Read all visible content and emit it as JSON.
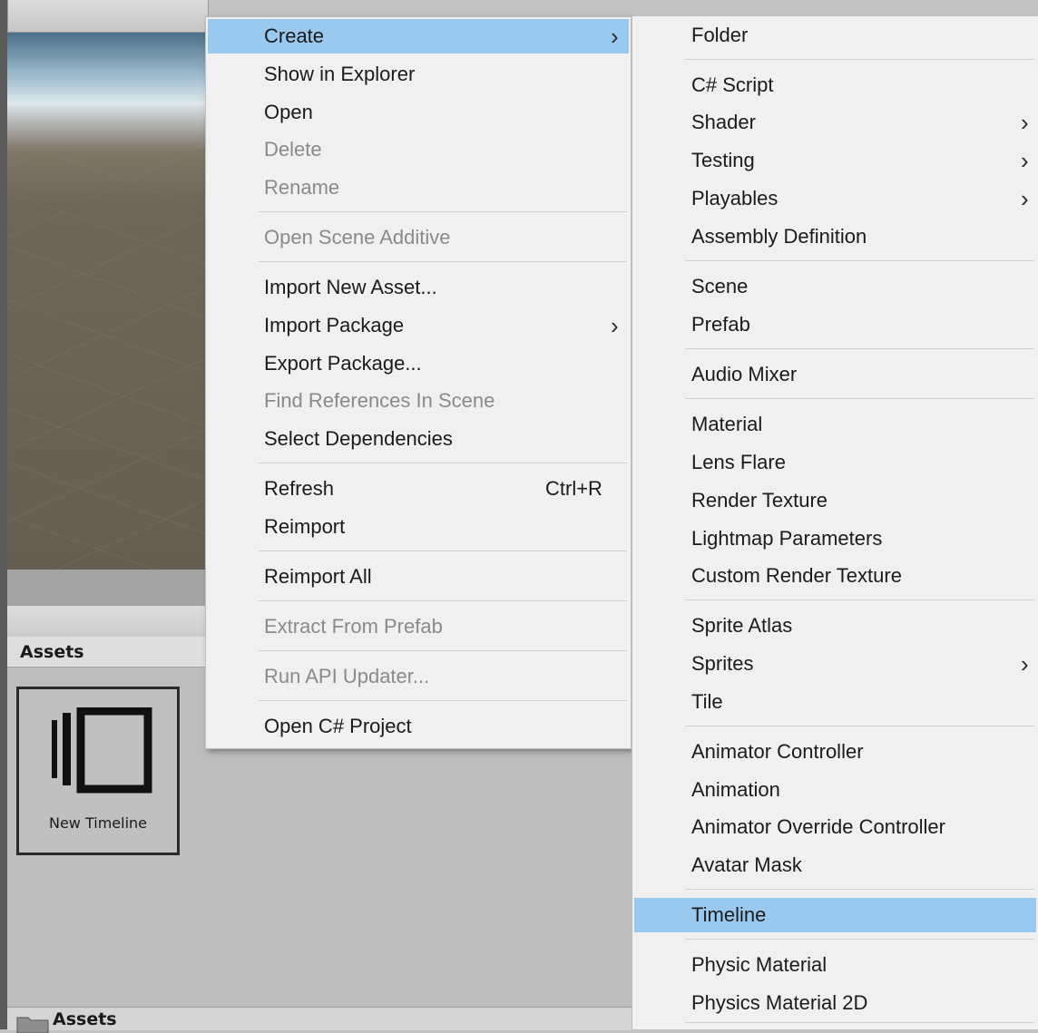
{
  "project": {
    "assets_header": "Assets",
    "asset_tile_label": "New Timeline",
    "status_label": "Assets"
  },
  "context_menu": {
    "items": [
      {
        "label": "Create",
        "submenu": true,
        "highlighted": true
      },
      {
        "label": "Show in Explorer"
      },
      {
        "label": "Open"
      },
      {
        "label": "Delete",
        "disabled": true
      },
      {
        "label": "Rename",
        "disabled": true
      },
      {
        "label": "Open Scene Additive",
        "disabled": true
      },
      {
        "label": "Import New Asset..."
      },
      {
        "label": "Import Package",
        "submenu": true
      },
      {
        "label": "Export Package..."
      },
      {
        "label": "Find References In Scene",
        "disabled": true
      },
      {
        "label": "Select Dependencies"
      },
      {
        "label": "Refresh",
        "shortcut": "Ctrl+R"
      },
      {
        "label": "Reimport"
      },
      {
        "label": "Reimport All"
      },
      {
        "label": "Extract From Prefab",
        "disabled": true
      },
      {
        "label": "Run API Updater...",
        "disabled": true
      },
      {
        "label": "Open C# Project"
      }
    ]
  },
  "create_submenu": {
    "items": [
      {
        "label": "Folder"
      },
      {
        "label": "C# Script"
      },
      {
        "label": "Shader",
        "submenu": true
      },
      {
        "label": "Testing",
        "submenu": true
      },
      {
        "label": "Playables",
        "submenu": true
      },
      {
        "label": "Assembly Definition"
      },
      {
        "label": "Scene"
      },
      {
        "label": "Prefab"
      },
      {
        "label": "Audio Mixer"
      },
      {
        "label": "Material"
      },
      {
        "label": "Lens Flare"
      },
      {
        "label": "Render Texture"
      },
      {
        "label": "Lightmap Parameters"
      },
      {
        "label": "Custom Render Texture"
      },
      {
        "label": "Sprite Atlas"
      },
      {
        "label": "Sprites",
        "submenu": true
      },
      {
        "label": "Tile"
      },
      {
        "label": "Animator Controller"
      },
      {
        "label": "Animation"
      },
      {
        "label": "Animator Override Controller"
      },
      {
        "label": "Avatar Mask"
      },
      {
        "label": "Timeline",
        "highlighted": true
      },
      {
        "label": "Physic Material"
      },
      {
        "label": "Physics Material 2D"
      }
    ]
  },
  "icons": {
    "submenu_arrow": "chevron-right-icon",
    "asset": "timeline-asset-icon",
    "status": "folder-icon"
  },
  "colors": {
    "highlight": "#99c9ef",
    "menu_bg": "#f0f0f0",
    "disabled_text": "#8a8a8a"
  }
}
